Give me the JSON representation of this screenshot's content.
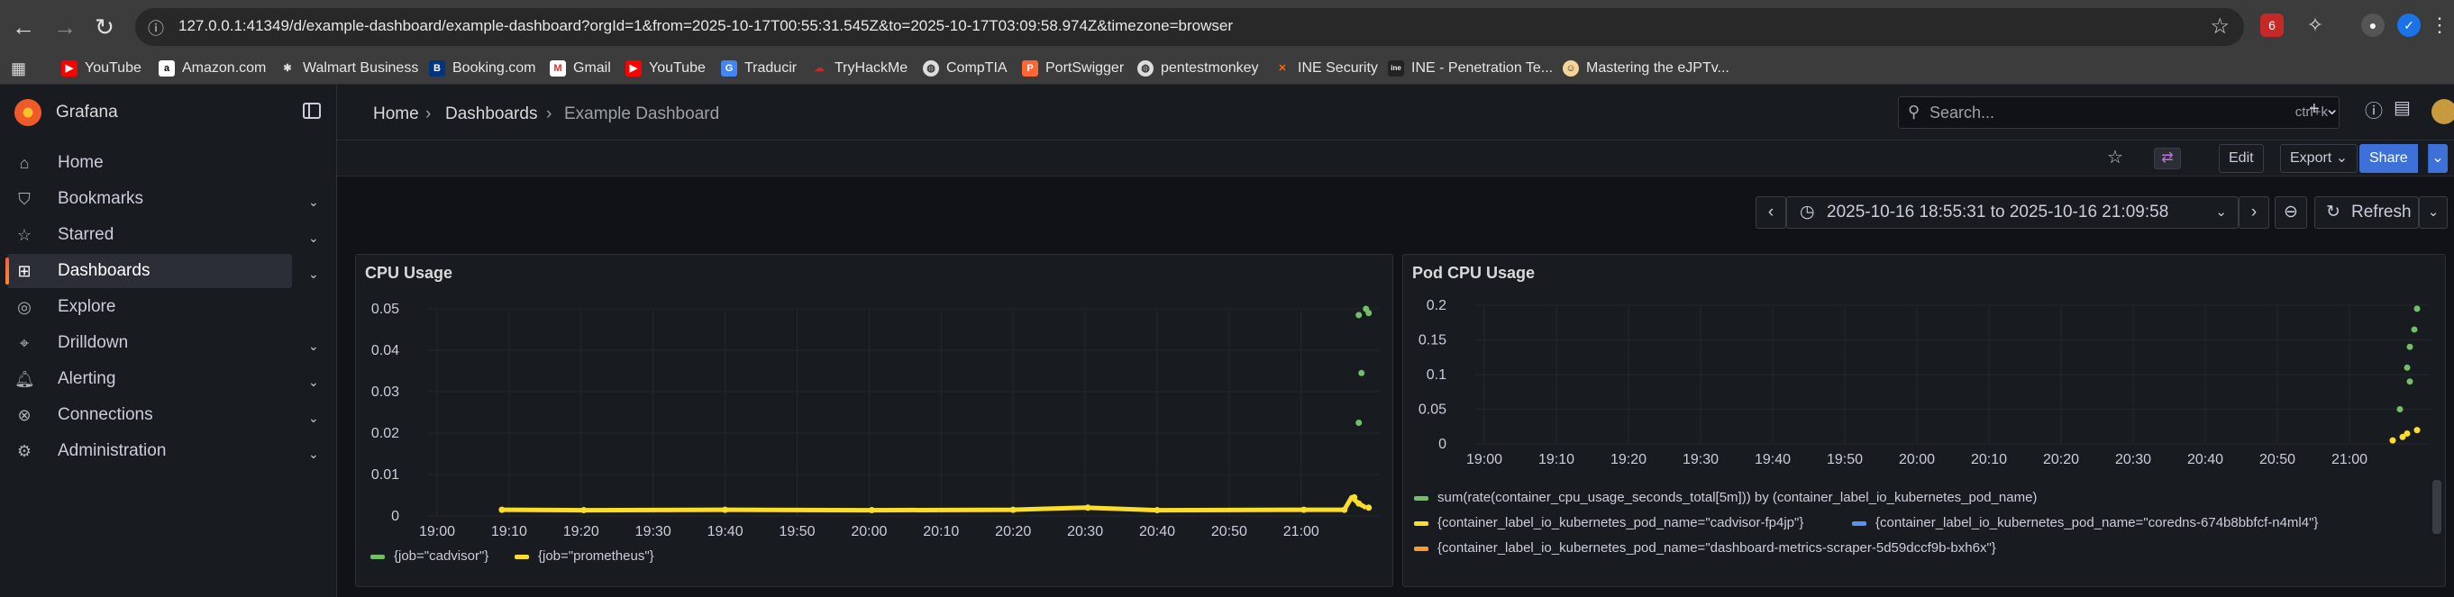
{
  "browser": {
    "url": "127.0.0.1:41349/d/example-dashboard/example-dashboard?orgId=1&from=2025-10-17T00:55:31.545Z&to=2025-10-17T03:09:58.974Z&timezone=browser",
    "bookmarks": [
      "YouTube",
      "Amazon.com",
      "Walmart Business",
      "Booking.com",
      "Gmail",
      "YouTube",
      "Traducir",
      "TryHackMe",
      "CompTIA",
      "PortSwigger",
      "pentestmonkey",
      "INE Security",
      "INE - Penetration Te...",
      "Mastering the eJPTv..."
    ]
  },
  "sidebar": {
    "brand": "Grafana",
    "items": [
      {
        "label": "Home",
        "icon": "home-icon",
        "chevron": false
      },
      {
        "label": "Bookmarks",
        "icon": "bookmark-icon",
        "chevron": true
      },
      {
        "label": "Starred",
        "icon": "star-icon",
        "chevron": true
      },
      {
        "label": "Dashboards",
        "icon": "apps-icon",
        "chevron": true,
        "active": true
      },
      {
        "label": "Explore",
        "icon": "compass-icon",
        "chevron": false
      },
      {
        "label": "Drilldown",
        "icon": "drilldown-icon",
        "chevron": true
      },
      {
        "label": "Alerting",
        "icon": "bell-icon",
        "chevron": true
      },
      {
        "label": "Connections",
        "icon": "connections-icon",
        "chevron": true
      },
      {
        "label": "Administration",
        "icon": "cog-icon",
        "chevron": true
      }
    ]
  },
  "topbar": {
    "breadcrumb": [
      "Home",
      "Dashboards",
      "Example Dashboard"
    ],
    "search_placeholder": "Search...",
    "search_shortcut": "ctrl+k"
  },
  "actions": {
    "edit": "Edit",
    "export": "Export",
    "share": "Share"
  },
  "timepicker": {
    "range": "2025-10-16 18:55:31 to 2025-10-16 21:09:58",
    "refresh": "Refresh"
  },
  "colors": {
    "green": "#73bf69",
    "yellow": "#fade2a",
    "blue": "#5794f2",
    "orange": "#ff9830",
    "accent": "#f05a28"
  },
  "panels": [
    {
      "title": "CPU Usage"
    },
    {
      "title": "Pod CPU Usage"
    }
  ],
  "chart_data": [
    {
      "type": "line",
      "title": "CPU Usage",
      "x_ticks": [
        "19:00",
        "19:10",
        "19:20",
        "19:30",
        "19:40",
        "19:50",
        "20:00",
        "20:10",
        "20:20",
        "20:30",
        "20:40",
        "20:50",
        "21:00"
      ],
      "y_ticks": [
        "0",
        "0.01",
        "0.02",
        "0.03",
        "0.04",
        "0.05"
      ],
      "ylim": [
        0,
        0.05
      ],
      "series": [
        {
          "name": "{job=\"cadvisor\"}",
          "color": "#73bf69",
          "points": [
            [
              "21:08",
              0.0225
            ],
            [
              "21:08",
              0.0345
            ],
            [
              "21:08",
              0.0485
            ],
            [
              "21:09",
              0.049
            ],
            [
              "21:09",
              0.05
            ]
          ]
        },
        {
          "name": "{job=\"prometheus\"}",
          "color": "#fade2a",
          "points": [
            [
              "19:09",
              0.0015
            ],
            [
              "19:20",
              0.0014
            ],
            [
              "19:40",
              0.0015
            ],
            [
              "20:00",
              0.0014
            ],
            [
              "20:20",
              0.0015
            ],
            [
              "20:30",
              0.002
            ],
            [
              "20:40",
              0.0014
            ],
            [
              "21:00",
              0.0015
            ],
            [
              "21:06",
              0.0015
            ],
            [
              "21:07",
              0.0045
            ],
            [
              "21:08",
              0.003
            ],
            [
              "21:09",
              0.002
            ]
          ]
        }
      ],
      "legend_placement": "bottom"
    },
    {
      "type": "line",
      "title": "Pod CPU Usage",
      "x_ticks": [
        "19:00",
        "19:10",
        "19:20",
        "19:30",
        "19:40",
        "19:50",
        "20:00",
        "20:10",
        "20:20",
        "20:30",
        "20:40",
        "20:50",
        "21:00"
      ],
      "y_ticks": [
        "0",
        "0.05",
        "0.1",
        "0.15",
        "0.2"
      ],
      "ylim": [
        0,
        0.2
      ],
      "series": [
        {
          "name": "sum(rate(container_cpu_usage_seconds_total[5m])) by (container_label_io_kubernetes_pod_name)",
          "color": "#73bf69",
          "points": [
            [
              "21:07",
              0.05
            ],
            [
              "21:08",
              0.09
            ],
            [
              "21:08",
              0.11
            ],
            [
              "21:08",
              0.14
            ],
            [
              "21:09",
              0.165
            ],
            [
              "21:09",
              0.195
            ]
          ]
        },
        {
          "name": "{container_label_io_kubernetes_pod_name=\"cadvisor-fp4jp\"}",
          "color": "#fade2a",
          "points": [
            [
              "21:06",
              0.005
            ],
            [
              "21:07",
              0.01
            ],
            [
              "21:08",
              0.015
            ],
            [
              "21:09",
              0.02
            ]
          ]
        },
        {
          "name": "{container_label_io_kubernetes_pod_name=\"coredns-674b8bbfcf-n4ml4\"}",
          "color": "#5794f2",
          "points": []
        },
        {
          "name": "{container_label_io_kubernetes_pod_name=\"dashboard-metrics-scraper-5d59dccf9b-bxh6x\"}",
          "color": "#ff9830",
          "points": []
        }
      ],
      "legend_placement": "bottom"
    }
  ]
}
